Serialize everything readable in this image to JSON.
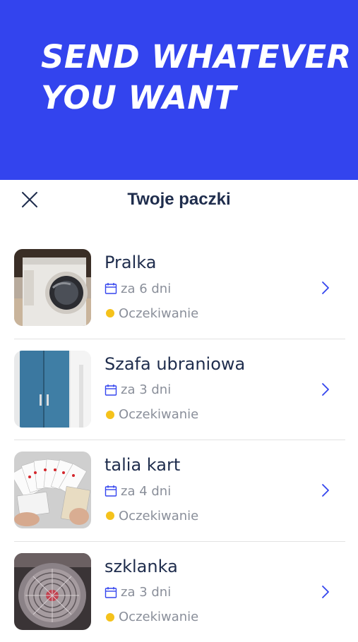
{
  "hero": {
    "title_line1": "SEND WHATEVER",
    "title_line2": "YOU WANT",
    "background_color": "#3344ee"
  },
  "header": {
    "title": "Twoje paczki",
    "close_icon": "close-icon"
  },
  "colors": {
    "text_primary": "#1f2d4d",
    "text_secondary": "#8a8f9a",
    "accent": "#3344ee",
    "status_pending": "#f5c21b"
  },
  "packages": [
    {
      "name": "Pralka",
      "date": "za 6 dni",
      "status": "Oczekiwanie",
      "thumbnail": "washing-machine-photo"
    },
    {
      "name": "Szafa ubraniowa",
      "date": "za 3 dni",
      "status": "Oczekiwanie",
      "thumbnail": "wardrobe-photo"
    },
    {
      "name": "talia kart",
      "date": "za 4 dni",
      "status": "Oczekiwanie",
      "thumbnail": "playing-cards-photo"
    },
    {
      "name": "szklanka",
      "date": "za 3 dni",
      "status": "Oczekiwanie",
      "thumbnail": "glass-photo"
    }
  ]
}
